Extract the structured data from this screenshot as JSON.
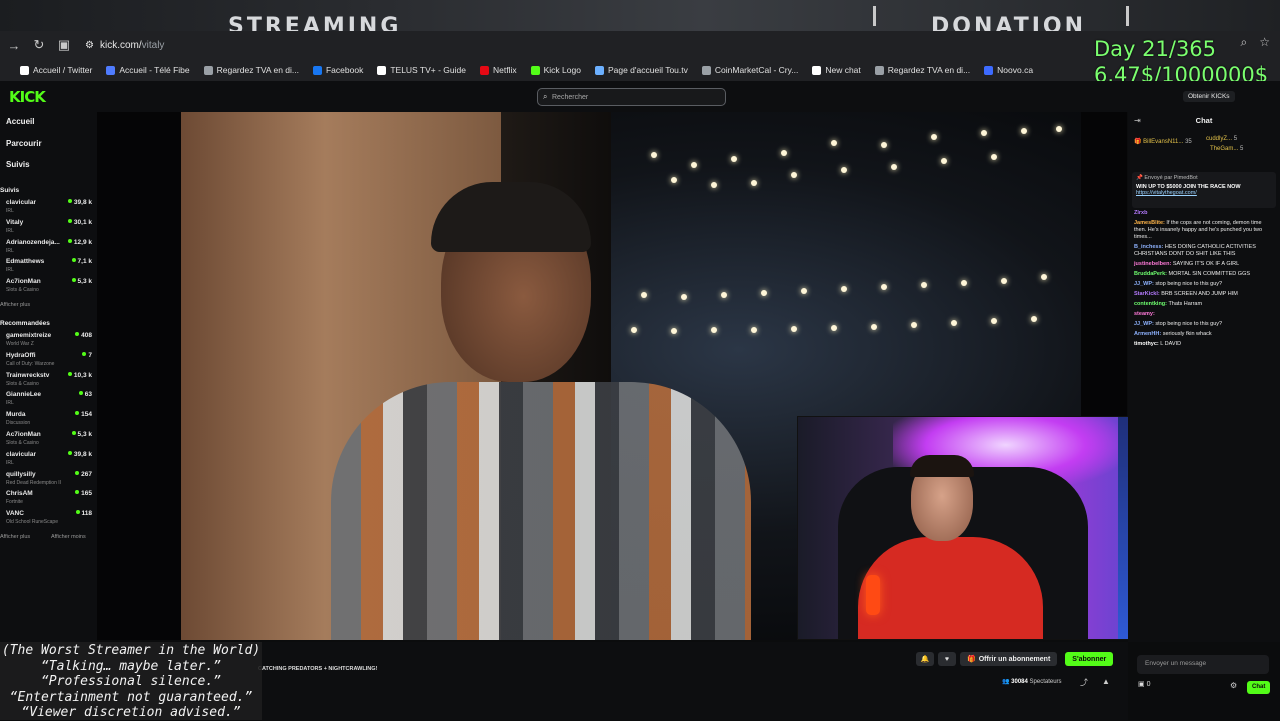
{
  "overlay_top": {
    "left_text": "STREAMING",
    "right_text": "DONATION"
  },
  "browser": {
    "url_scheme": "kick.com/",
    "url_path": "vitaly",
    "bookmarks": [
      {
        "label": "Accueil / Twitter",
        "color": "#ffffff"
      },
      {
        "label": "Accueil - Télé Fibe",
        "color": "#4f7cff"
      },
      {
        "label": "Regardez TVA en di...",
        "color": "#9aa0a6"
      },
      {
        "label": "Facebook",
        "color": "#1877f2"
      },
      {
        "label": "TELUS TV+ - Guide",
        "color": "#ffffff"
      },
      {
        "label": "Netflix",
        "color": "#e50914"
      },
      {
        "label": "Kick Logo",
        "color": "#53fc18"
      },
      {
        "label": "Page d'accueil Tou.tv",
        "color": "#6cb0ff"
      },
      {
        "label": "CoinMarketCal - Cry...",
        "color": "#9aa0a6"
      },
      {
        "label": "New chat",
        "color": "#ffffff"
      },
      {
        "label": "Regardez TVA en di...",
        "color": "#9aa0a6"
      },
      {
        "label": "Noovo.ca",
        "color": "#3d6bff"
      }
    ]
  },
  "stats_overlay": {
    "day": "Day 21/365",
    "money": "6.47$/1000000$"
  },
  "kick": {
    "logo": "KICK",
    "search_placeholder": "Rechercher",
    "get_kicks": "Obtenir KICKs",
    "nav": {
      "home": "Accueil",
      "browse": "Parcourir",
      "following": "Suivis"
    },
    "following_section": "Suivis",
    "following": [
      {
        "name": "clavicular",
        "category": "IRL",
        "viewers": "39,8 k"
      },
      {
        "name": "Vitaly",
        "category": "IRL",
        "viewers": "30,1 k"
      },
      {
        "name": "Adrianozendeja...",
        "category": "IRL",
        "viewers": "12,9 k"
      },
      {
        "name": "Edmatthews",
        "category": "IRL",
        "viewers": "7,1 k"
      },
      {
        "name": "Ac7ionMan",
        "category": "Slots & Casino",
        "viewers": "5,3 k"
      }
    ],
    "show_more": "Afficher plus",
    "recommended_section": "Recommandées",
    "recommended": [
      {
        "name": "gamemixtreize",
        "category": "World War Z",
        "viewers": "408"
      },
      {
        "name": "HydraOffi",
        "category": "Call of Duty: Warzone",
        "viewers": "7"
      },
      {
        "name": "Trainwreckstv",
        "category": "Slots & Casino",
        "viewers": "10,3 k"
      },
      {
        "name": "GiannieLee",
        "category": "IRL",
        "viewers": "63"
      },
      {
        "name": "Murda",
        "category": "Discussion",
        "viewers": "154"
      },
      {
        "name": "Ac7ionMan",
        "category": "Slots & Casino",
        "viewers": "5,3 k"
      },
      {
        "name": "clavicular",
        "category": "IRL",
        "viewers": "39,8 k"
      },
      {
        "name": "quillysilly",
        "category": "Red Dead Redemption II",
        "viewers": "267"
      },
      {
        "name": "ChrisAM",
        "category": "Fortnite",
        "viewers": "165"
      },
      {
        "name": "VANC",
        "category": "Old School RuneScape",
        "viewers": "118"
      }
    ],
    "show_more2": "Afficher plus",
    "show_less": "Afficher moins"
  },
  "chat": {
    "title": "Chat",
    "gifters": [
      {
        "name": "BillEvansN11...",
        "count": "35"
      },
      {
        "name": "cuddlyZ...",
        "count": "5"
      },
      {
        "name": "TheGam...",
        "count": "5"
      }
    ],
    "pinned": {
      "sent_by_label": "Envoyé par",
      "sent_by": "PimedBot",
      "message": "WIN UP TO $5000 JOIN THE RACE NOW",
      "link": "https://vitalythegoat.com/"
    },
    "messages": [
      {
        "user": "Zlrxb",
        "color": "#b67bff",
        "text": ""
      },
      {
        "user": "JamesBlite:",
        "color": "#ffb54a",
        "text": "If the cops are not coming, demon time then. He's insanely happy and he's punched you two times..."
      },
      {
        "user": "B_inchess:",
        "color": "#8fb3ff",
        "text": "HES DOING CATHOLIC ACTIVITIES CHRISTIANS DONT DO SHIT LIKE THIS"
      },
      {
        "user": "justinebelben:",
        "color": "#ff7ad9",
        "text": "SAYING IT'S OK IF A GIRL"
      },
      {
        "user": "BruddaPerk:",
        "color": "#6fff6f",
        "text": "MORTAL SIN COMMITTED GGS"
      },
      {
        "user": "JJ_WP:",
        "color": "#8fb3ff",
        "text": "stop being nice to this guy?"
      },
      {
        "user": "StarKickl:",
        "color": "#b67bff",
        "text": "BRB SCREEN AND JUMP HIM"
      },
      {
        "user": "contentking:",
        "color": "#6fff6f",
        "text": "Thats Harram"
      },
      {
        "user": "steamy:",
        "color": "#ff7ad9",
        "text": ""
      },
      {
        "user": "JJ_WP:",
        "color": "#8fb3ff",
        "text": "stop being nice to this guy?"
      },
      {
        "user": "ArmenHH:",
        "color": "#8fb3ff",
        "text": "seriously fkin whack"
      },
      {
        "user": "timothyc:",
        "color": "#ffffff",
        "text": "L DAVID"
      }
    ],
    "input_placeholder": "Envoyer un message",
    "points": "0",
    "send": "Chat"
  },
  "stream": {
    "title_snippet": "CATCHING PREDATORS + NIGHTCRAWLING!",
    "gift_sub": "Offrir un abonnement",
    "subscribe": "S'abonner",
    "viewers": "30084",
    "viewers_label": "Spectateurs"
  },
  "caption_overlay": {
    "lines": [
      "(The Worst Streamer in the World)",
      "“Talking… maybe later.”",
      "“Professional silence.”",
      "“Entertainment not guaranteed.”",
      "“Viewer discretion advised.”"
    ]
  },
  "colors": {
    "kick_green": "#53fc18",
    "overlay_green": "#7bff6f"
  }
}
